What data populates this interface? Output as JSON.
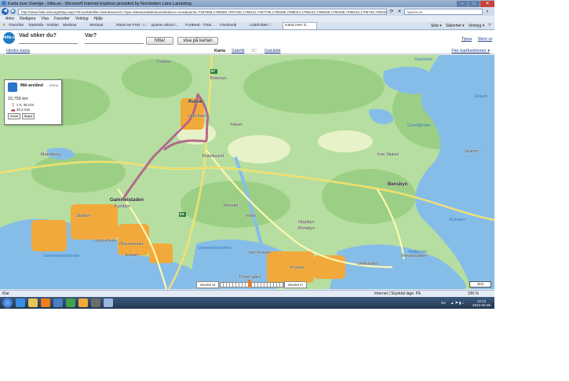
{
  "window": {
    "title": "Karta över Sverige - hitta.se - Microsoft Internet Explorer provided by Norrbotten Läns Landsting",
    "minimize": "–",
    "maximize": "□",
    "close": "✕"
  },
  "address": {
    "url": "http://www.hitta.se/LargeMap.aspx?ShowSatellite=false&Search=Type=Measure&Measuredistance=true&points=7297658,1786066,7297436,1786212,7297728,1786288,7298024,1786444,7298038,1786488,7298232,1786738,7298188,1786894",
    "search_placeholder": "lapona.se"
  },
  "menu": [
    "Arkiv",
    "Redigera",
    "Visa",
    "Favoriter",
    "Verktyg",
    "Hjälp"
  ],
  "favorites_label": "Favoriter",
  "tabs": [
    "Startsida - Insidan",
    "Medusa",
    "Medusa",
    "Razer.se Post - I...",
    "opinion about i...",
    "FunBeat - Träni...",
    "Facebook",
    "Luleå-tiden ::",
    "Karta över S..."
  ],
  "tab_tools": [
    "Sida ▾",
    "Säkerhet ▾",
    "Verktyg ▾",
    "?"
  ],
  "hitta": {
    "logo": "hitta.se",
    "q1": "Vad söker du?",
    "q2": "Var?",
    "search_btn": "hitta!",
    "map_btn": "visa på kartan",
    "print": "Tipsa",
    "write": "Skriv ut"
  },
  "maptool": {
    "hide": "Hindre karta",
    "karta": "Karta",
    "satellit": "Satellit",
    "sep": "3D",
    "gatubild": "Gatubild",
    "more": "Fler kartfunktioner ▾"
  },
  "measure": {
    "title": "Mät avstånd",
    "close": "stäng",
    "distance": "10,755 km",
    "walk": "1 h, 46 min",
    "car": "32,2 min",
    "reset": "rensa",
    "undo": "ångra"
  },
  "places": {
    "flarken": "Flarken",
    "brannan": "Brännan",
    "rutvik": "Rutvik",
    "hammeri": "Hammeri",
    "naset": "Näset",
    "rutviksund": "Rutviksund",
    "maneberg": "Maneberg",
    "gammelstaden": "Gammelstaden",
    "kyrkbyn": "Kyrkbyn",
    "stadion": "Stadion",
    "ingnosheim": "Ingnosheim",
    "ohemmanet": "Öhemmanet",
    "exkam": "Exkam",
    "revelin": "Revelin",
    "inbyn": "Inbyn",
    "oppibyn": "Oppibyn",
    "bonsbyn": "Bönsbyn",
    "inre_skaret": "Inre Skäret",
    "bensbyn": "Bensbyn",
    "granon": "Granön",
    "reveln_sodra": "Revelsudden",
    "sundet": "Sirkkundet",
    "porso_gard": "Porsö gård",
    "porson": "Porsön",
    "stora_porsoe": "Stor-Porsön"
  },
  "waters": {
    "svartviken": "Svartviken",
    "stroyon": "Stråpön",
    "granosfjarden": "Granöfjärden",
    "gammelstadsfjarden": "Gammelstadsfjärden",
    "gammelstadsviken": "Gammelstadsviken",
    "mulviken": "Multviken",
    "holtfjarden": "Holtfjärden"
  },
  "roads": [
    "97",
    "E4"
  ],
  "zoom": {
    "out": "Zoome ut",
    "in": "Zoome in"
  },
  "scale": "1km",
  "status": {
    "left": "Klar",
    "zone": "Internet | Skyddat läge: På",
    "zoom": "100 %"
  },
  "tray": {
    "lang": "SV",
    "time": "12:13",
    "date": "2012-02-26"
  },
  "colors": {
    "route": "#b05c8a",
    "forest": "#9fd18a",
    "water": "#7fb8e6",
    "urban": "#f2a93b"
  }
}
